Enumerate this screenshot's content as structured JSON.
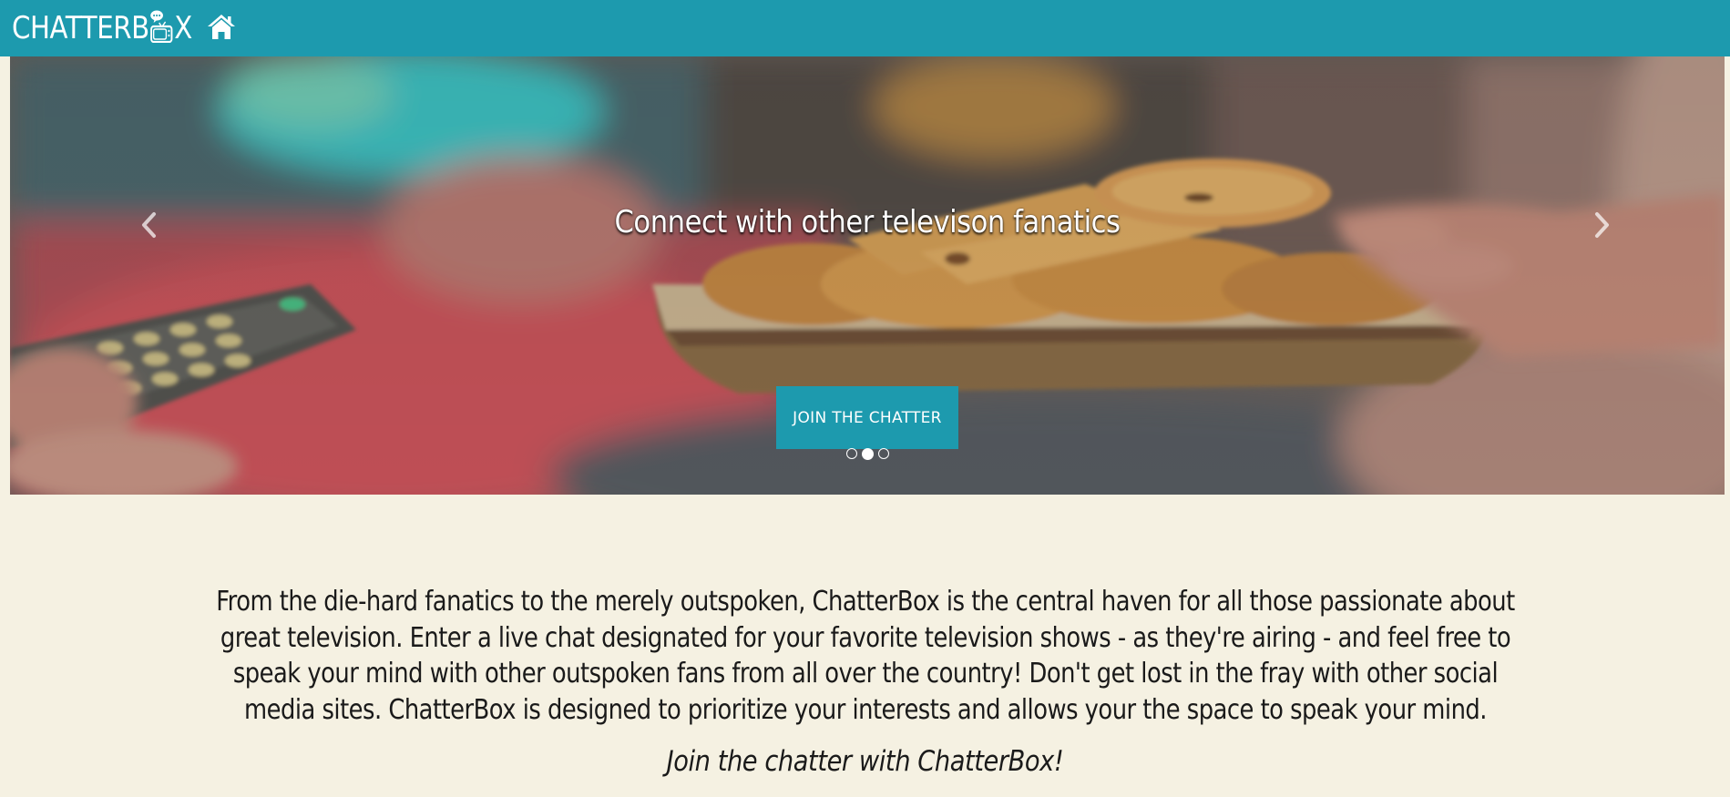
{
  "navbar": {
    "brand_prefix": "CHATTERB",
    "brand_suffix": "X",
    "brand_icon": "tv-chat-bubble-icon",
    "home_icon": "home-icon",
    "background": "#1d9aae"
  },
  "hero": {
    "caption": "Connect with other televison fanatics",
    "cta_label": "JOIN THE CHATTER",
    "prev_icon": "chevron-left-icon",
    "next_icon": "chevron-right-icon",
    "slides_count": 3,
    "active_slide": 2,
    "accent": "#1d9aae"
  },
  "intro": {
    "paragraph": "From the die-hard fanatics to the merely outspoken, ChatterBox is the central haven for all those passionate about great television. Enter a live chat designated for your favorite television shows - as they're airing - and feel free to speak your mind with other outspoken fans from all over the country! Don't get lost in the fray with other social media sites. ChatterBox is designed to prioritize your interests and allows your the space to speak your mind.",
    "tagline": "Join the chatter with ChatterBox!"
  },
  "page": {
    "background": "#f5f1e2"
  }
}
